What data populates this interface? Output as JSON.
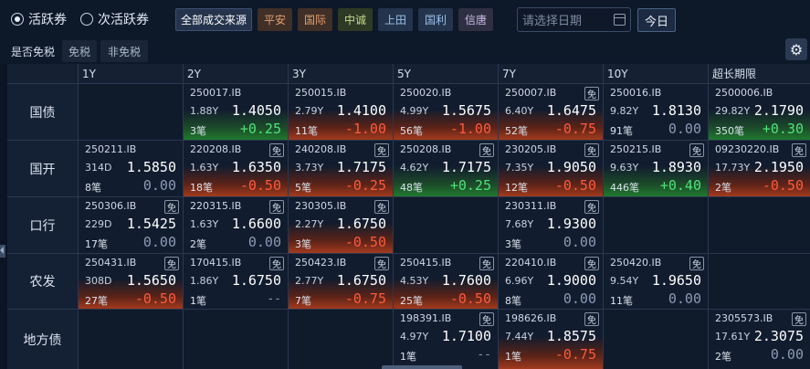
{
  "top": {
    "radio_active": "活跃券",
    "radio_sub": "次活跃券",
    "source_all": "全部成交来源",
    "sources": [
      "平安",
      "国际",
      "中诚",
      "上田",
      "国利",
      "信唐"
    ],
    "source_colors": [
      "#3f2f26",
      "#3f2f26",
      "#2e3a25",
      "#23344c",
      "#23344c",
      "#2f2f42"
    ],
    "source_text_colors": [
      "#e2a070",
      "#e2a070",
      "#c3d98a",
      "#9cc0ea",
      "#9cc0ea",
      "#c9b8e6"
    ],
    "date_placeholder": "请选择日期",
    "today_label": "今日"
  },
  "tax": {
    "label": "是否免税",
    "options": [
      "免税",
      "非免税"
    ]
  },
  "columns": [
    "1Y",
    "2Y",
    "3Y",
    "5Y",
    "7Y",
    "10Y",
    "超长期限"
  ],
  "rows": [
    "国债",
    "国开",
    "口行",
    "农发",
    "地方债"
  ],
  "exempt_label": "免",
  "cells": [
    [
      null,
      {
        "code": "250017.IB",
        "term": "1.88Y",
        "price": "1.4050",
        "count": "3笔",
        "change": "+0.25",
        "dir": "down",
        "exempt": false
      },
      {
        "code": "250015.IB",
        "term": "2.79Y",
        "price": "1.4100",
        "count": "11笔",
        "change": "-1.00",
        "dir": "up",
        "exempt": false
      },
      {
        "code": "250020.IB",
        "term": "4.99Y",
        "price": "1.5675",
        "count": "56笔",
        "change": "-1.00",
        "dir": "up",
        "exempt": false
      },
      {
        "code": "250007.IB",
        "term": "6.40Y",
        "price": "1.6475",
        "count": "52笔",
        "change": "-0.75",
        "dir": "up",
        "exempt": true
      },
      {
        "code": "250016.IB",
        "term": "9.82Y",
        "price": "1.8130",
        "count": "91笔",
        "change": "0.00",
        "dir": "flat",
        "exempt": false
      },
      {
        "code": "2500006.IB",
        "term": "29.82Y",
        "price": "2.1790",
        "count": "350笔",
        "change": "+0.30",
        "dir": "down",
        "exempt": false
      }
    ],
    [
      {
        "code": "250211.IB",
        "term": "314D",
        "price": "1.5850",
        "count": "8笔",
        "change": "0.00",
        "dir": "flat",
        "exempt": false
      },
      {
        "code": "220208.IB",
        "term": "1.63Y",
        "price": "1.6350",
        "count": "18笔",
        "change": "-0.50",
        "dir": "up",
        "exempt": true
      },
      {
        "code": "240208.IB",
        "term": "3.73Y",
        "price": "1.7175",
        "count": "5笔",
        "change": "-0.25",
        "dir": "up",
        "exempt": true
      },
      {
        "code": "250208.IB",
        "term": "4.62Y",
        "price": "1.7175",
        "count": "48笔",
        "change": "+0.25",
        "dir": "down",
        "exempt": true
      },
      {
        "code": "230205.IB",
        "term": "7.35Y",
        "price": "1.9050",
        "count": "12笔",
        "change": "-0.50",
        "dir": "up",
        "exempt": true
      },
      {
        "code": "250215.IB",
        "term": "9.63Y",
        "price": "1.8930",
        "count": "446笔",
        "change": "+0.40",
        "dir": "down",
        "exempt": true
      },
      {
        "code": "09230220.IB",
        "term": "17.73Y",
        "price": "2.1950",
        "count": "2笔",
        "change": "-0.50",
        "dir": "up",
        "exempt": true
      }
    ],
    [
      {
        "code": "250306.IB",
        "term": "229D",
        "price": "1.5425",
        "count": "17笔",
        "change": "0.00",
        "dir": "flat",
        "exempt": true
      },
      {
        "code": "220315.IB",
        "term": "1.63Y",
        "price": "1.6600",
        "count": "2笔",
        "change": "0.00",
        "dir": "flat",
        "exempt": true
      },
      {
        "code": "230305.IB",
        "term": "2.27Y",
        "price": "1.6750",
        "count": "3笔",
        "change": "-0.50",
        "dir": "up",
        "exempt": true
      },
      null,
      {
        "code": "230311.IB",
        "term": "7.68Y",
        "price": "1.9300",
        "count": "3笔",
        "change": "0.00",
        "dir": "flat",
        "exempt": true
      },
      null,
      null
    ],
    [
      {
        "code": "250431.IB",
        "term": "308D",
        "price": "1.5650",
        "count": "27笔",
        "change": "-0.50",
        "dir": "up",
        "exempt": true
      },
      {
        "code": "170415.IB",
        "term": "1.86Y",
        "price": "1.6750",
        "count": "1笔",
        "change": "--",
        "dir": "none",
        "exempt": true
      },
      {
        "code": "250423.IB",
        "term": "2.77Y",
        "price": "1.6750",
        "count": "7笔",
        "change": "-0.75",
        "dir": "up",
        "exempt": true
      },
      {
        "code": "250415.IB",
        "term": "4.53Y",
        "price": "1.7600",
        "count": "25笔",
        "change": "-0.50",
        "dir": "up",
        "exempt": true
      },
      {
        "code": "220410.IB",
        "term": "6.96Y",
        "price": "1.9000",
        "count": "8笔",
        "change": "0.00",
        "dir": "flat",
        "exempt": true
      },
      {
        "code": "250420.IB",
        "term": "9.54Y",
        "price": "1.9650",
        "count": "11笔",
        "change": "0.00",
        "dir": "flat",
        "exempt": true
      },
      null
    ],
    [
      null,
      null,
      null,
      {
        "code": "198391.IB",
        "term": "4.97Y",
        "price": "1.7100",
        "count": "1笔",
        "change": "--",
        "dir": "none",
        "exempt": true
      },
      {
        "code": "198626.IB",
        "term": "7.44Y",
        "price": "1.8575",
        "count": "1笔",
        "change": "-0.75",
        "dir": "up",
        "exempt": true
      },
      null,
      {
        "code": "2305573.IB",
        "term": "17.61Y",
        "price": "2.3075",
        "count": "2笔",
        "change": "0.00",
        "dir": "flat",
        "exempt": true
      }
    ]
  ]
}
